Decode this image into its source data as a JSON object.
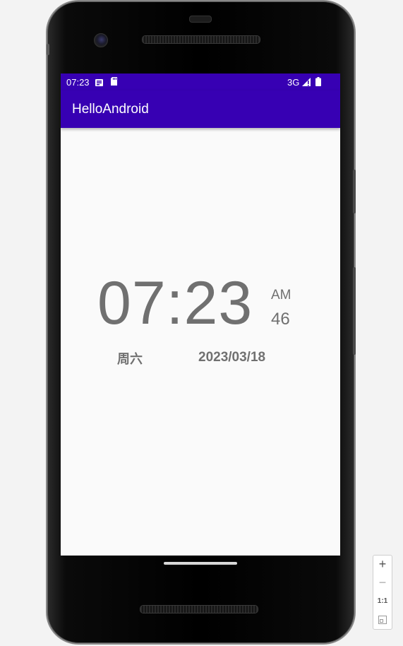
{
  "status_bar": {
    "time": "07:23",
    "network": "3G",
    "icons": [
      "notification-icon",
      "sd-card-icon",
      "signal-icon",
      "battery-icon"
    ]
  },
  "app_bar": {
    "title": "HelloAndroid"
  },
  "clock": {
    "time": "07:23",
    "am_pm": "AM",
    "seconds": "46",
    "weekday": "周六",
    "date": "2023/03/18"
  },
  "zoom_controls": {
    "zoom_in": "+",
    "zoom_out": "−",
    "actual_size": "1:1"
  },
  "colors": {
    "primary": "#3700b3",
    "clock_text": "#707070",
    "screen_bg": "#fafafa"
  }
}
